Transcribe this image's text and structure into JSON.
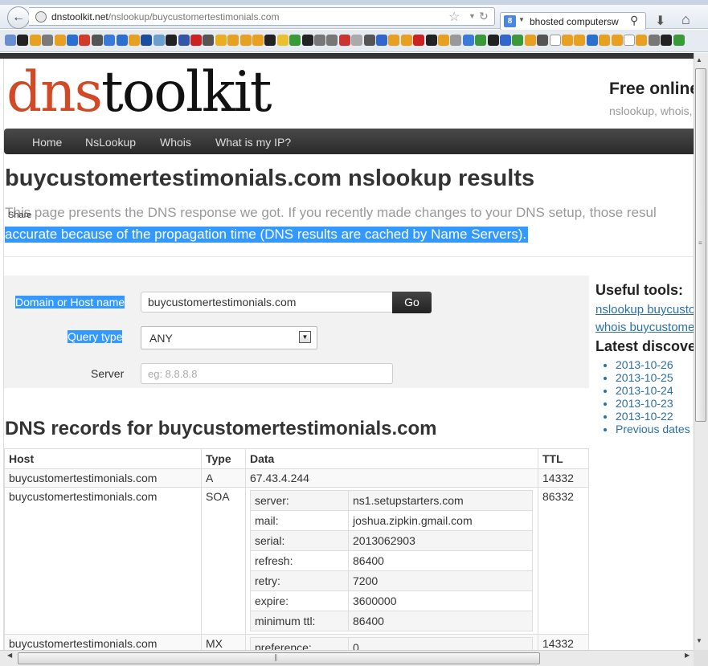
{
  "browser": {
    "url_domain": "dnstoolkit.net",
    "url_path": "/nslookup/buycustomertestimonials.com",
    "search_engine_badge": "8",
    "search_text": "bhosted computersw",
    "icons": {
      "back": "arrow-left-icon",
      "star": "star-icon",
      "reload": "reload-icon",
      "search": "magnifier-icon",
      "download": "download-icon",
      "home": "home-icon"
    },
    "bookmark_colors": [
      "#6a8fd1",
      "#222222",
      "#e8a020",
      "#7a7a7a",
      "#e8a020",
      "#2b6fd1",
      "#d23a2a",
      "#555555",
      "#3a7ad9",
      "#2b6fd1",
      "#e8a020",
      "#1a4fa0",
      "#6aa0d0",
      "#222222",
      "#3355aa",
      "#cc2222",
      "#555555",
      "#e8b020",
      "#e8a020",
      "#e8a020",
      "#e8a020",
      "#222222",
      "#e8c030",
      "#3a9a3a",
      "#222222",
      "#777777",
      "#777777",
      "#cc3333",
      "#aaaaaa",
      "#555555",
      "#3366cc",
      "#e8a020",
      "#e8a020",
      "#cc2222",
      "#222222",
      "#e8a020",
      "#999999",
      "#3a7ad9",
      "#3a9a3a",
      "#222222",
      "#3366cc",
      "#3a9a3a",
      "#e8a020",
      "#555555",
      "#ffffff",
      "#e8a020",
      "#e8a020",
      "#2b6fd1",
      "#e8a020",
      "#e8a020",
      "#ffffff",
      "#e8a020",
      "#777777",
      "#222222",
      "#3a9a3a"
    ]
  },
  "site": {
    "logo_part1": "dns",
    "logo_part2": "toolkit",
    "tagline": "Free online",
    "tagline_sub": "nslookup, whois,",
    "nav": [
      "Home",
      "NsLookup",
      "Whois",
      "What is my IP?"
    ],
    "accent_color": "#d14a28"
  },
  "main": {
    "title": "buycustomertestimonials.com nslookup results",
    "share": "Share",
    "intro_line1": "This page presents the DNS response we got. If you recently made changes to your DNS setup, those resul",
    "intro_line2": "accurate because of the propagation time (DNS results are cached by Name Servers).",
    "form": {
      "domain_label": "Domain or Host name",
      "domain_value": "buycustomertestimonials.com",
      "go_label": "Go",
      "query_label": "Query type",
      "query_value": "ANY",
      "server_label": "Server",
      "server_placeholder": "eg: 8.8.8.8"
    },
    "records_title": "DNS records for buycustomertestimonials.com",
    "table": {
      "headers": [
        "Host",
        "Type",
        "Data",
        "TTL"
      ],
      "a_record": {
        "host": "buycustomertestimonials.com",
        "type": "A",
        "data": "67.43.4.244",
        "ttl": "14332"
      },
      "soa_record": {
        "host": "buycustomertestimonials.com",
        "type": "SOA",
        "ttl": "86332",
        "rows": [
          {
            "k": "server:",
            "v": "ns1.setupstarters.com"
          },
          {
            "k": "mail:",
            "v": "joshua.zipkin.gmail.com"
          },
          {
            "k": "serial:",
            "v": "2013062903"
          },
          {
            "k": "refresh:",
            "v": "86400"
          },
          {
            "k": "retry:",
            "v": "7200"
          },
          {
            "k": "expire:",
            "v": "3600000"
          },
          {
            "k": "minimum ttl:",
            "v": "86400"
          }
        ]
      },
      "mx_record": {
        "host": "buycustomertestimonials.com",
        "type": "MX",
        "ttl": "14332",
        "k": "preference:",
        "v": "0"
      }
    }
  },
  "sidebar": {
    "useful_title": "Useful tools:",
    "links": [
      "nslookup buycusto",
      "whois buycustome"
    ],
    "latest_title": "Latest discove",
    "dates": [
      "2013-10-26",
      "2013-10-25",
      "2013-10-24",
      "2013-10-23",
      "2013-10-22",
      "Previous dates"
    ]
  }
}
